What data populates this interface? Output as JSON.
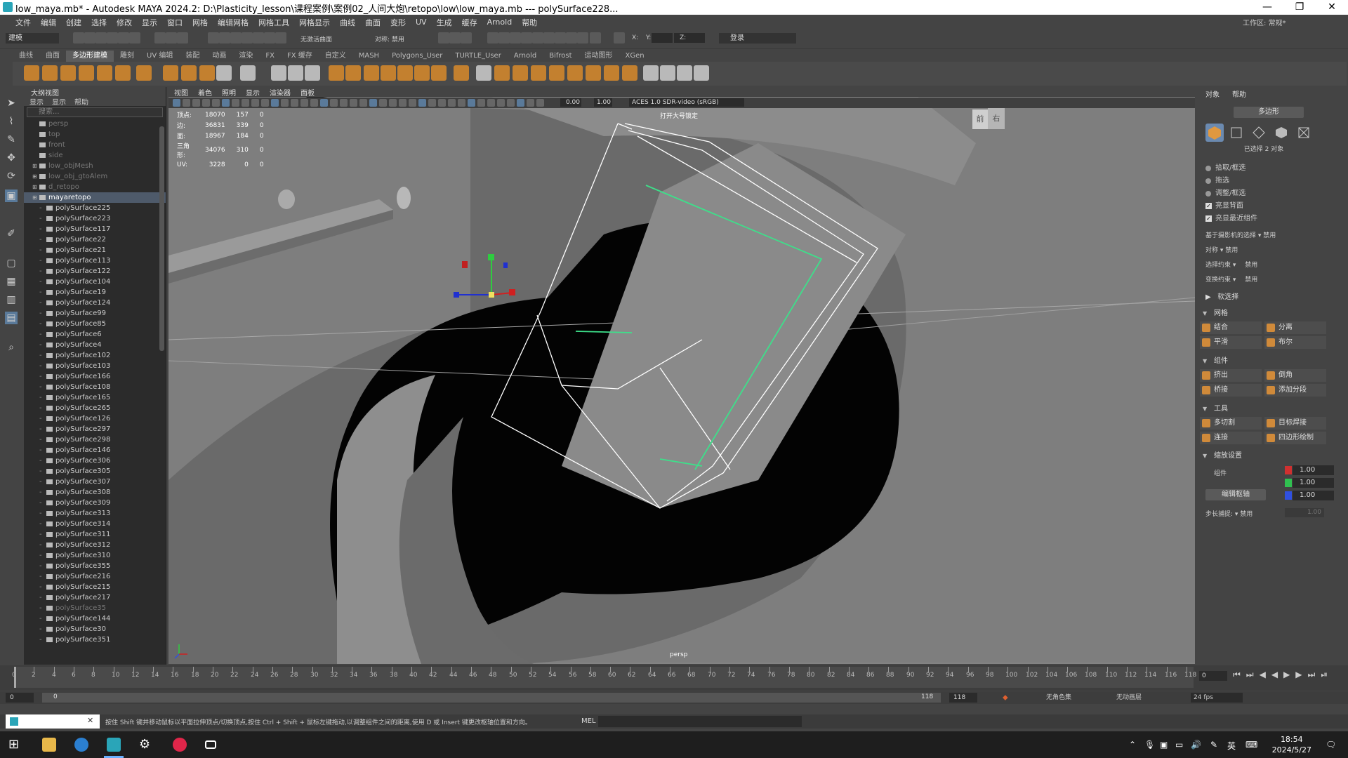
{
  "window": {
    "title": "low_maya.mb* - Autodesk MAYA 2024.2: D:\\Plasticity_lesson\\课程案例\\案例02_人间大炮\\retopo\\low\\low_maya.mb  ---  polySurface228...",
    "workspace_label": "工作区:",
    "workspace_value": "常规*"
  },
  "menu": [
    "文件",
    "编辑",
    "创建",
    "选择",
    "修改",
    "显示",
    "窗口",
    "网格",
    "编辑网格",
    "网格工具",
    "网格显示",
    "曲线",
    "曲面",
    "变形",
    "UV",
    "生成",
    "缓存",
    "Arnold",
    "帮助"
  ],
  "toolbar": {
    "mode_select": "建模",
    "symmetry_label": "对称: 禁用",
    "no_live_surface": "无激活曲面",
    "x_label": "X:",
    "y_label": "Y:",
    "z_label": "Z:",
    "login_label": "登录"
  },
  "shelf_tabs": [
    "曲线",
    "曲面",
    "多边形建模",
    "雕刻",
    "UV 编辑",
    "装配",
    "动画",
    "渲染",
    "FX",
    "FX 缓存",
    "自定义",
    "MASH",
    "Polygons_User",
    "TURTLE_User",
    "Arnold",
    "Bifrost",
    "运动图形",
    "XGen"
  ],
  "shelf_active": "多边形建模",
  "outliner": {
    "title": "大纲视图",
    "menu": [
      "显示",
      "显示",
      "帮助"
    ],
    "search_placeholder": "搜索...",
    "items": [
      {
        "label": "persp",
        "dim": true,
        "sel": false,
        "expand": false,
        "indent": 1
      },
      {
        "label": "top",
        "dim": true,
        "sel": false,
        "expand": false,
        "indent": 1
      },
      {
        "label": "front",
        "dim": true,
        "sel": false,
        "expand": false,
        "indent": 1
      },
      {
        "label": "side",
        "dim": true,
        "sel": false,
        "expand": false,
        "indent": 1
      },
      {
        "label": "low_objMesh",
        "dim": true,
        "sel": false,
        "expand": true,
        "indent": 0
      },
      {
        "label": "low_obj_gtoAlem",
        "dim": true,
        "sel": false,
        "expand": true,
        "indent": 0
      },
      {
        "label": "d_retopo",
        "dim": true,
        "sel": false,
        "expand": true,
        "indent": 0
      },
      {
        "label": "mayaretopo",
        "dim": false,
        "sel": true,
        "expand": true,
        "indent": 0
      },
      {
        "label": "polySurface225",
        "dim": false,
        "sel": false,
        "expand": false,
        "indent": 2
      },
      {
        "label": "polySurface223",
        "dim": false,
        "sel": false,
        "expand": false,
        "indent": 2
      },
      {
        "label": "polySurface117",
        "dim": false,
        "sel": false,
        "expand": false,
        "indent": 2
      },
      {
        "label": "polySurface22",
        "dim": false,
        "sel": false,
        "expand": false,
        "indent": 2
      },
      {
        "label": "polySurface21",
        "dim": false,
        "sel": false,
        "expand": false,
        "indent": 2
      },
      {
        "label": "polySurface113",
        "dim": false,
        "sel": false,
        "expand": false,
        "indent": 2
      },
      {
        "label": "polySurface122",
        "dim": false,
        "sel": false,
        "expand": false,
        "indent": 2
      },
      {
        "label": "polySurface104",
        "dim": false,
        "sel": false,
        "expand": false,
        "indent": 2
      },
      {
        "label": "polySurface19",
        "dim": false,
        "sel": false,
        "expand": false,
        "indent": 2
      },
      {
        "label": "polySurface124",
        "dim": false,
        "sel": false,
        "expand": false,
        "indent": 2
      },
      {
        "label": "polySurface99",
        "dim": false,
        "sel": false,
        "expand": false,
        "indent": 2
      },
      {
        "label": "polySurface85",
        "dim": false,
        "sel": false,
        "expand": false,
        "indent": 2
      },
      {
        "label": "polySurface6",
        "dim": false,
        "sel": false,
        "expand": false,
        "indent": 2
      },
      {
        "label": "polySurface4",
        "dim": false,
        "sel": false,
        "expand": false,
        "indent": 2
      },
      {
        "label": "polySurface102",
        "dim": false,
        "sel": false,
        "expand": false,
        "indent": 2
      },
      {
        "label": "polySurface103",
        "dim": false,
        "sel": false,
        "expand": false,
        "indent": 2
      },
      {
        "label": "polySurface166",
        "dim": false,
        "sel": false,
        "expand": false,
        "indent": 2
      },
      {
        "label": "polySurface108",
        "dim": false,
        "sel": false,
        "expand": false,
        "indent": 2
      },
      {
        "label": "polySurface165",
        "dim": false,
        "sel": false,
        "expand": false,
        "indent": 2
      },
      {
        "label": "polySurface265",
        "dim": false,
        "sel": false,
        "expand": false,
        "indent": 2
      },
      {
        "label": "polySurface126",
        "dim": false,
        "sel": false,
        "expand": false,
        "indent": 2
      },
      {
        "label": "polySurface297",
        "dim": false,
        "sel": false,
        "expand": false,
        "indent": 2
      },
      {
        "label": "polySurface298",
        "dim": false,
        "sel": false,
        "expand": false,
        "indent": 2
      },
      {
        "label": "polySurface146",
        "dim": false,
        "sel": false,
        "expand": false,
        "indent": 2
      },
      {
        "label": "polySurface306",
        "dim": false,
        "sel": false,
        "expand": false,
        "indent": 2
      },
      {
        "label": "polySurface305",
        "dim": false,
        "sel": false,
        "expand": false,
        "indent": 2
      },
      {
        "label": "polySurface307",
        "dim": false,
        "sel": false,
        "expand": false,
        "indent": 2
      },
      {
        "label": "polySurface308",
        "dim": false,
        "sel": false,
        "expand": false,
        "indent": 2
      },
      {
        "label": "polySurface309",
        "dim": false,
        "sel": false,
        "expand": false,
        "indent": 2
      },
      {
        "label": "polySurface313",
        "dim": false,
        "sel": false,
        "expand": false,
        "indent": 2
      },
      {
        "label": "polySurface314",
        "dim": false,
        "sel": false,
        "expand": false,
        "indent": 2
      },
      {
        "label": "polySurface311",
        "dim": false,
        "sel": false,
        "expand": false,
        "indent": 2
      },
      {
        "label": "polySurface312",
        "dim": false,
        "sel": false,
        "expand": false,
        "indent": 2
      },
      {
        "label": "polySurface310",
        "dim": false,
        "sel": false,
        "expand": false,
        "indent": 2
      },
      {
        "label": "polySurface355",
        "dim": false,
        "sel": false,
        "expand": false,
        "indent": 2
      },
      {
        "label": "polySurface216",
        "dim": false,
        "sel": false,
        "expand": false,
        "indent": 2
      },
      {
        "label": "polySurface215",
        "dim": false,
        "sel": false,
        "expand": false,
        "indent": 2
      },
      {
        "label": "polySurface217",
        "dim": false,
        "sel": false,
        "expand": false,
        "indent": 2
      },
      {
        "label": "polySurface35",
        "dim": true,
        "sel": false,
        "expand": false,
        "indent": 2
      },
      {
        "label": "polySurface144",
        "dim": false,
        "sel": false,
        "expand": false,
        "indent": 2
      },
      {
        "label": "polySurface30",
        "dim": false,
        "sel": false,
        "expand": false,
        "indent": 2
      },
      {
        "label": "polySurface351",
        "dim": false,
        "sel": false,
        "expand": false,
        "indent": 2
      }
    ]
  },
  "viewport": {
    "menu": [
      "视图",
      "着色",
      "照明",
      "显示",
      "渲染器",
      "面板"
    ],
    "field_value_1": "0.00",
    "field_value_2": "1.00",
    "colorspace": "ACES 1.0 SDR-video (sRGB)",
    "camera_label": "persp",
    "hint_text": "打开大号锁定",
    "hud": [
      {
        "label": "顶点:",
        "a": "18070",
        "b": "157",
        "c": "0"
      },
      {
        "label": "边:",
        "a": "36831",
        "b": "339",
        "c": "0"
      },
      {
        "label": "面:",
        "a": "18967",
        "b": "184",
        "c": "0"
      },
      {
        "label": "三角形:",
        "a": "34076",
        "b": "310",
        "c": "0"
      },
      {
        "label": "UV:",
        "a": "3228",
        "b": "0",
        "c": "0"
      }
    ],
    "viewcube_front": "前",
    "viewcube_right": "右"
  },
  "right_panel": {
    "tabs": [
      "对象",
      "帮助"
    ],
    "header_btn": "多边形",
    "selected_count": "已选择 2 对象",
    "options": [
      {
        "label": "拾取/框选",
        "type": "radio"
      },
      {
        "label": "拖选",
        "type": "radio"
      },
      {
        "label": "调整/框选",
        "type": "radio"
      },
      {
        "label": "亮显背面",
        "type": "check"
      },
      {
        "label": "亮显最近组件",
        "type": "check"
      }
    ],
    "camera_sel": "基于摄影机的选择",
    "camera_sel_val": "禁用",
    "symmetry": "对称",
    "symmetry_val": "禁用",
    "sel_constraint": "选择约束",
    "sel_constraint_val": "禁用",
    "xform_constraint": "变换约束",
    "xform_constraint_val": "禁用",
    "soft_select": "软选择",
    "sec_mesh": "网格",
    "mesh_tools": [
      "结合",
      "分离",
      "平滑",
      "布尔"
    ],
    "sec_component": "组件",
    "component_tools": [
      "挤出",
      "倒角",
      "桥接",
      "添加分段"
    ],
    "sec_tools": "工具",
    "tool_tools": [
      "多切割",
      "目标焊接",
      "连接",
      "四边形绘制"
    ],
    "sec_scale": "缩放设置",
    "component_label": "组件",
    "edit_pivot": "编辑枢轴",
    "scale_x": "1.00",
    "scale_y": "1.00",
    "scale_z": "1.00",
    "step_snap": "步长捕捉:",
    "step_snap_val": "禁用",
    "step_value": "1.00"
  },
  "timeline": {
    "ticks": [
      "0",
      "2",
      "4",
      "6",
      "8",
      "10",
      "12",
      "14",
      "16",
      "18",
      "20",
      "22",
      "24",
      "26",
      "28",
      "30",
      "32",
      "34",
      "36",
      "38",
      "40",
      "42",
      "44",
      "46",
      "48",
      "50",
      "52",
      "54",
      "56",
      "58",
      "60",
      "62",
      "64",
      "66",
      "68",
      "70",
      "72",
      "74",
      "76",
      "78",
      "80",
      "82",
      "84",
      "86",
      "88",
      "90",
      "92",
      "94",
      "96",
      "98",
      "100",
      "102",
      "104",
      "106",
      "108",
      "110",
      "112",
      "114",
      "116",
      "118"
    ],
    "current_frame": "0"
  },
  "range": {
    "start": "0",
    "start_inner": "0",
    "end_inner": "118",
    "end": "118",
    "char_set": "无角色集",
    "anim_layer": "无动画层",
    "fps": "24 fps"
  },
  "cmdline": {
    "help_text": "按住 Shift 键并移动鼠标以平面拉伸顶点/切换顶点,按住 Ctrl + Shift + 鼠标左键拖动,以调整组件之间的距离,使用 D 或 Insert 键更改枢轴位置和方向。",
    "lang": "MEL"
  },
  "taskbar": {
    "time": "18:54",
    "date": "2024/5/27",
    "ime": "英"
  }
}
